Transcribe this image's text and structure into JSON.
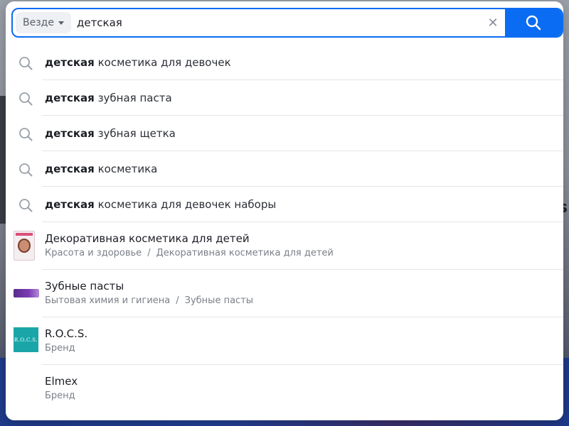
{
  "search": {
    "scope_label": "Везде",
    "query": "детская"
  },
  "suggestions": [
    {
      "bold": "детская",
      "rest": " косметика для девочек"
    },
    {
      "bold": "детская",
      "rest": " зубная паста"
    },
    {
      "bold": "детская",
      "rest": " зубная щетка"
    },
    {
      "bold": "детская",
      "rest": " косметика"
    },
    {
      "bold": "детская",
      "rest": " косметика для девочек наборы"
    }
  ],
  "categories": [
    {
      "title": "Декоративная косметика для детей",
      "path": [
        "Красота и здоровье",
        "Декоративная косметика для детей"
      ],
      "separator": "/"
    },
    {
      "title": "Зубные пасты",
      "path": [
        "Бытовая химия и гигиена",
        "Зубные пасты"
      ],
      "separator": "/"
    }
  ],
  "brands": [
    {
      "title": "R.O.C.S.",
      "sub": "Бренд",
      "logo_text": "R.O.C.S."
    },
    {
      "title": "Elmex",
      "sub": "Бренд"
    }
  ],
  "colors": {
    "accent": "#0a6cf3",
    "rocs_logo": "#1aa6a8"
  },
  "backdrop": {
    "edge_text": "s"
  }
}
